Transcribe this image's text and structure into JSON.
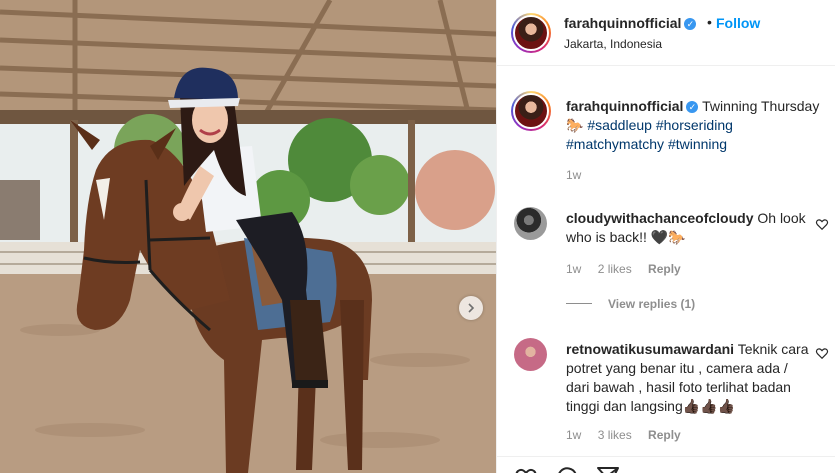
{
  "post": {
    "username": "farahquinnofficial",
    "follow_label": "Follow",
    "separator": "•",
    "location": "Jakarta, Indonesia"
  },
  "caption": {
    "username": "farahquinnofficial",
    "text": "Twinning Thursday",
    "emoji": "🐎",
    "hashtags": [
      "#saddleup",
      "#horseriding",
      "#matchymatchy",
      "#twinning"
    ],
    "time": "1w"
  },
  "comments": [
    {
      "username": "cloudywithachanceofcloudy",
      "text": "Oh look who is back!! 🖤🐎",
      "time": "1w",
      "likes": "2 likes",
      "reply": "Reply",
      "view_replies": "View replies (1)"
    },
    {
      "username": "retnowatikusumawardani",
      "text": "Teknik cara potret yang benar itu , camera ada / dari bawah , hasil foto terlihat badan tinggi dan langsing👍🏿👍🏿👍🏿",
      "time": "1w",
      "likes": "3 likes",
      "reply": "Reply"
    }
  ],
  "icons": [
    "verified-badge-icon",
    "heart-icon",
    "comment-icon",
    "share-icon",
    "chevron-right-icon"
  ],
  "colors": {
    "link": "#0095f6",
    "hashtag": "#00376b",
    "muted": "#8e8e8e",
    "verified": "#3897f0"
  }
}
